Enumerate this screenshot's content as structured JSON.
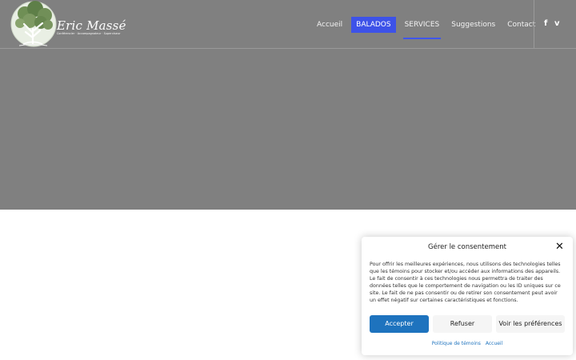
{
  "logo": {
    "name": "Eric Massé",
    "tagline": "Conférencier · Accompagnateur · Superviseur",
    "icon": "tree-logo-icon"
  },
  "nav": {
    "items": [
      {
        "label": "Accueil"
      },
      {
        "label": "BALADOS"
      },
      {
        "label": "SERVICES"
      },
      {
        "label": "Suggestions"
      },
      {
        "label": "Contact"
      }
    ],
    "active_index": 1,
    "underlined_index": 2
  },
  "social": {
    "facebook": "f",
    "vimeo": "v"
  },
  "colors": {
    "hero": "#808080",
    "nav_active": "#3d52e8",
    "accept_button": "#1e73be"
  },
  "cookie": {
    "title": "Gérer le consentement",
    "close_icon": "close-icon",
    "text": "Pour offrir les meilleures expériences, nous utilisons des technologies telles que les témoins pour stocker et/ou accéder aux informations des appareils. Le fait de consentir à ces technologies nous permettra de traiter des données telles que le comportement de navigation ou les ID uniques sur ce site. Le fait de ne pas consentir ou de retirer son consentement peut avoir un effet négatif sur certaines caractéristiques et fonctions.",
    "accept_label": "Accepter",
    "refuse_label": "Refuser",
    "preferences_label": "Voir les préférences",
    "links": [
      "Politique de témoins",
      "Accueil"
    ]
  }
}
